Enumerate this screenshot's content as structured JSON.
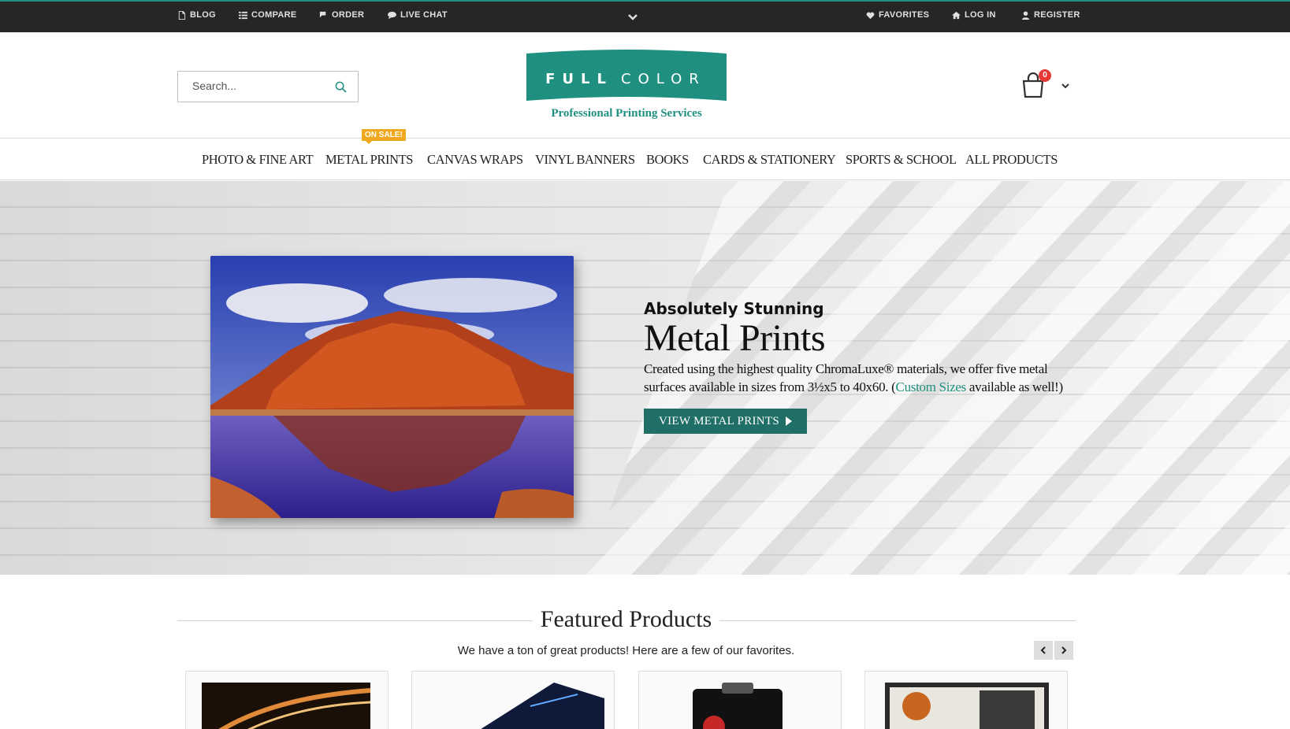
{
  "topbar": {
    "blog": "BLOG",
    "compare": "COMPARE",
    "order": "ORDER",
    "live_chat": "LIVE CHAT",
    "favorites": "FAVORITES",
    "log_in": "LOG IN",
    "register": "REGISTER"
  },
  "header": {
    "search_placeholder": "Search...",
    "logo_left": "FULL",
    "logo_right": "COLOR",
    "tagline": "Professional Printing Services",
    "cart_count": "0"
  },
  "nav": {
    "items": [
      "PHOTO & FINE ART",
      "METAL PRINTS",
      "CANVAS WRAPS",
      "VINYL BANNERS",
      "BOOKS",
      "CARDS & STATIONERY",
      "SPORTS & SCHOOL",
      "ALL PRODUCTS"
    ],
    "sale_badge": "ON SALE!"
  },
  "hero": {
    "pretitle": "Absolutely Stunning",
    "title": "Metal Prints",
    "desc_before": "Created using the highest quality ChromaLuxe® materials, we offer five metal surfaces available in sizes from 3½x5 to 40x60. (",
    "desc_link": "Custom Sizes",
    "desc_after": " available as well!)",
    "cta": "VIEW METAL PRINTS"
  },
  "featured": {
    "title": "Featured Products",
    "subtitle": "We have a ton of great products! Here are a few of our favorites."
  },
  "colors": {
    "brand_teal": "#1f8f7f",
    "topbar_bg": "#262626",
    "sale_orange": "#f0a81e",
    "cart_badge": "#e53935"
  }
}
